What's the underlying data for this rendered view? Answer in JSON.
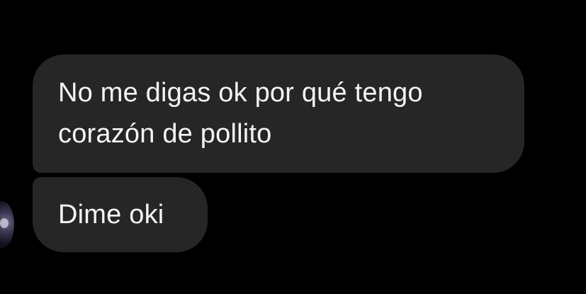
{
  "conversation": {
    "messages": [
      {
        "text": "No me digas ok por qué tengo\ncorazón de pollito"
      },
      {
        "text": "Dime oki"
      }
    ]
  },
  "colors": {
    "background": "#000000",
    "bubble": "#262626",
    "text": "#f4f4f4"
  },
  "icons": {
    "avatar": "contact-avatar-icon"
  }
}
